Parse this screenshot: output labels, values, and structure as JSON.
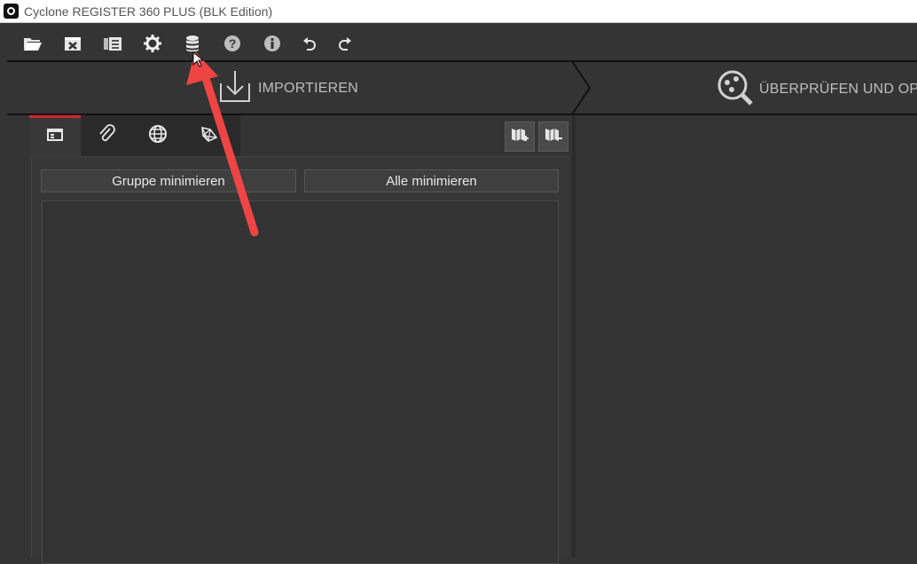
{
  "window": {
    "title": "Cyclone REGISTER 360 PLUS (BLK Edition)"
  },
  "toolbar": {
    "buttons": [
      {
        "icon": "folder-open-icon"
      },
      {
        "icon": "excel-export-icon"
      },
      {
        "icon": "report-icon"
      },
      {
        "icon": "gear-icon"
      },
      {
        "icon": "database-icon"
      },
      {
        "icon": "help-icon"
      },
      {
        "icon": "info-icon"
      },
      {
        "icon": "undo-icon"
      },
      {
        "icon": "redo-icon"
      }
    ]
  },
  "workflow": {
    "import_label": "IMPORTIEREN",
    "review_label": "ÜBERPRÜFEN UND OPT"
  },
  "panel": {
    "tabs": [
      {
        "icon": "project-tree-icon",
        "active": true
      },
      {
        "icon": "attachment-icon",
        "active": false
      },
      {
        "icon": "globe-icon",
        "active": false
      },
      {
        "icon": "network-icon",
        "active": false
      }
    ],
    "group_minimize_label": "Gruppe minimieren",
    "all_minimize_label": "Alle minimieren"
  },
  "colors": {
    "background": "#343434",
    "accent_red": "#d6232a",
    "annotation_arrow": "#ef4444"
  }
}
